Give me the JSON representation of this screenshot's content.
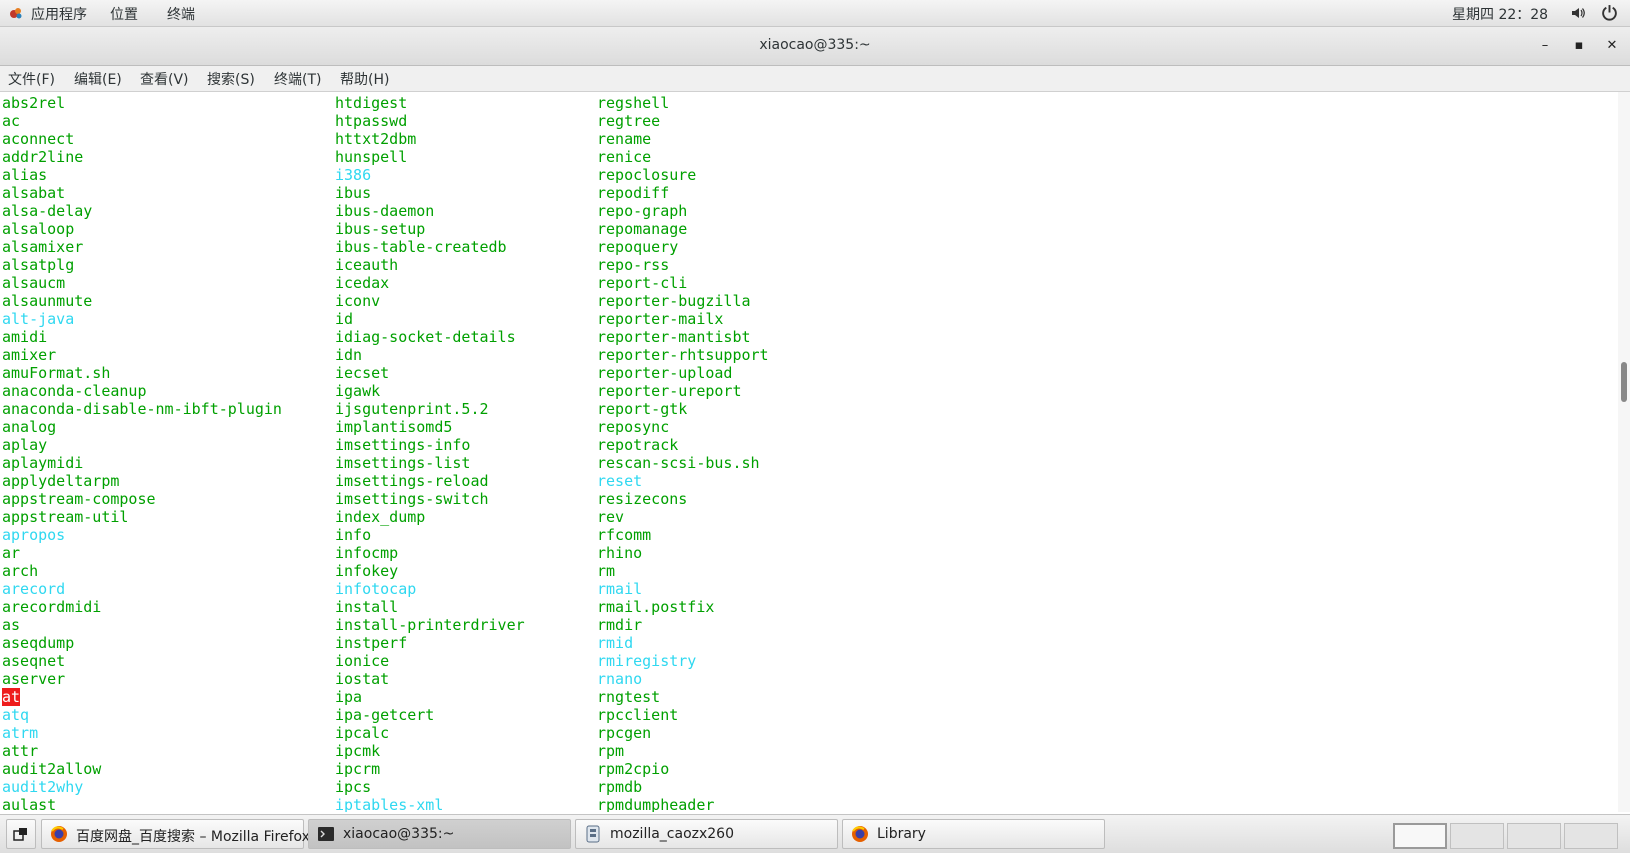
{
  "topbar": {
    "applications_label": "应用程序",
    "places_label": "位置",
    "terminal_app_label": "终端",
    "clock": "星期四 22：28"
  },
  "window": {
    "title": "xiaocao@335:~",
    "minimize_glyph": "–",
    "maximize_glyph": "▪",
    "close_glyph": "✕"
  },
  "menu": {
    "file": "文件(F)",
    "edit": "编辑(E)",
    "view": "查看(V)",
    "search": "搜索(S)",
    "terminal": "终端(T)",
    "help": "帮助(H)"
  },
  "terminal": {
    "colors": {
      "executable": "#00a000",
      "symlink": "#2fd8f0",
      "highlight_bg": "#ee1c1c"
    },
    "columns": [
      [
        {
          "t": "abs2rel",
          "k": "x"
        },
        {
          "t": "ac",
          "k": "x"
        },
        {
          "t": "aconnect",
          "k": "x"
        },
        {
          "t": "addr2line",
          "k": "x"
        },
        {
          "t": "alias",
          "k": "x"
        },
        {
          "t": "alsabat",
          "k": "x"
        },
        {
          "t": "alsa-delay",
          "k": "x"
        },
        {
          "t": "alsaloop",
          "k": "x"
        },
        {
          "t": "alsamixer",
          "k": "x"
        },
        {
          "t": "alsatplg",
          "k": "x"
        },
        {
          "t": "alsaucm",
          "k": "x"
        },
        {
          "t": "alsaunmute",
          "k": "x"
        },
        {
          "t": "alt-java",
          "k": "l"
        },
        {
          "t": "amidi",
          "k": "x"
        },
        {
          "t": "amixer",
          "k": "x"
        },
        {
          "t": "amuFormat.sh",
          "k": "x"
        },
        {
          "t": "anaconda-cleanup",
          "k": "x"
        },
        {
          "t": "anaconda-disable-nm-ibft-plugin",
          "k": "x"
        },
        {
          "t": "analog",
          "k": "x"
        },
        {
          "t": "aplay",
          "k": "x"
        },
        {
          "t": "aplaymidi",
          "k": "x"
        },
        {
          "t": "applydeltarpm",
          "k": "x"
        },
        {
          "t": "appstream-compose",
          "k": "x"
        },
        {
          "t": "appstream-util",
          "k": "x"
        },
        {
          "t": "apropos",
          "k": "l"
        },
        {
          "t": "ar",
          "k": "x"
        },
        {
          "t": "arch",
          "k": "x"
        },
        {
          "t": "arecord",
          "k": "l"
        },
        {
          "t": "arecordmidi",
          "k": "x"
        },
        {
          "t": "as",
          "k": "x"
        },
        {
          "t": "aseqdump",
          "k": "x"
        },
        {
          "t": "aseqnet",
          "k": "x"
        },
        {
          "t": "aserver",
          "k": "x"
        },
        {
          "t": "at",
          "k": "h"
        },
        {
          "t": "atq",
          "k": "l"
        },
        {
          "t": "atrm",
          "k": "l"
        },
        {
          "t": "attr",
          "k": "x"
        },
        {
          "t": "audit2allow",
          "k": "x"
        },
        {
          "t": "audit2why",
          "k": "l"
        },
        {
          "t": "aulast",
          "k": "x"
        }
      ],
      [
        {
          "t": "htdigest",
          "k": "x"
        },
        {
          "t": "htpasswd",
          "k": "x"
        },
        {
          "t": "httxt2dbm",
          "k": "x"
        },
        {
          "t": "hunspell",
          "k": "x"
        },
        {
          "t": "i386",
          "k": "l"
        },
        {
          "t": "ibus",
          "k": "x"
        },
        {
          "t": "ibus-daemon",
          "k": "x"
        },
        {
          "t": "ibus-setup",
          "k": "x"
        },
        {
          "t": "ibus-table-createdb",
          "k": "x"
        },
        {
          "t": "iceauth",
          "k": "x"
        },
        {
          "t": "icedax",
          "k": "x"
        },
        {
          "t": "iconv",
          "k": "x"
        },
        {
          "t": "id",
          "k": "x"
        },
        {
          "t": "idiag-socket-details",
          "k": "x"
        },
        {
          "t": "idn",
          "k": "x"
        },
        {
          "t": "iecset",
          "k": "x"
        },
        {
          "t": "igawk",
          "k": "x"
        },
        {
          "t": "ijsgutenprint.5.2",
          "k": "x"
        },
        {
          "t": "implantisomd5",
          "k": "x"
        },
        {
          "t": "imsettings-info",
          "k": "x"
        },
        {
          "t": "imsettings-list",
          "k": "x"
        },
        {
          "t": "imsettings-reload",
          "k": "x"
        },
        {
          "t": "imsettings-switch",
          "k": "x"
        },
        {
          "t": "index_dump",
          "k": "x"
        },
        {
          "t": "info",
          "k": "x"
        },
        {
          "t": "infocmp",
          "k": "x"
        },
        {
          "t": "infokey",
          "k": "x"
        },
        {
          "t": "infotocap",
          "k": "l"
        },
        {
          "t": "install",
          "k": "x"
        },
        {
          "t": "install-printerdriver",
          "k": "x"
        },
        {
          "t": "instperf",
          "k": "x"
        },
        {
          "t": "ionice",
          "k": "x"
        },
        {
          "t": "iostat",
          "k": "x"
        },
        {
          "t": "ipa",
          "k": "x"
        },
        {
          "t": "ipa-getcert",
          "k": "x"
        },
        {
          "t": "ipcalc",
          "k": "x"
        },
        {
          "t": "ipcmk",
          "k": "x"
        },
        {
          "t": "ipcrm",
          "k": "x"
        },
        {
          "t": "ipcs",
          "k": "x"
        },
        {
          "t": "iptables-xml",
          "k": "l"
        }
      ],
      [
        {
          "t": "regshell",
          "k": "x"
        },
        {
          "t": "regtree",
          "k": "x"
        },
        {
          "t": "rename",
          "k": "x"
        },
        {
          "t": "renice",
          "k": "x"
        },
        {
          "t": "repoclosure",
          "k": "x"
        },
        {
          "t": "repodiff",
          "k": "x"
        },
        {
          "t": "repo-graph",
          "k": "x"
        },
        {
          "t": "repomanage",
          "k": "x"
        },
        {
          "t": "repoquery",
          "k": "x"
        },
        {
          "t": "repo-rss",
          "k": "x"
        },
        {
          "t": "report-cli",
          "k": "x"
        },
        {
          "t": "reporter-bugzilla",
          "k": "x"
        },
        {
          "t": "reporter-mailx",
          "k": "x"
        },
        {
          "t": "reporter-mantisbt",
          "k": "x"
        },
        {
          "t": "reporter-rhtsupport",
          "k": "x"
        },
        {
          "t": "reporter-upload",
          "k": "x"
        },
        {
          "t": "reporter-ureport",
          "k": "x"
        },
        {
          "t": "report-gtk",
          "k": "x"
        },
        {
          "t": "reposync",
          "k": "x"
        },
        {
          "t": "repotrack",
          "k": "x"
        },
        {
          "t": "rescan-scsi-bus.sh",
          "k": "x"
        },
        {
          "t": "reset",
          "k": "l"
        },
        {
          "t": "resizecons",
          "k": "x"
        },
        {
          "t": "rev",
          "k": "x"
        },
        {
          "t": "rfcomm",
          "k": "x"
        },
        {
          "t": "rhino",
          "k": "x"
        },
        {
          "t": "rm",
          "k": "x"
        },
        {
          "t": "rmail",
          "k": "l"
        },
        {
          "t": "rmail.postfix",
          "k": "x"
        },
        {
          "t": "rmdir",
          "k": "x"
        },
        {
          "t": "rmid",
          "k": "l"
        },
        {
          "t": "rmiregistry",
          "k": "l"
        },
        {
          "t": "rnano",
          "k": "l"
        },
        {
          "t": "rngtest",
          "k": "x"
        },
        {
          "t": "rpcclient",
          "k": "x"
        },
        {
          "t": "rpcgen",
          "k": "x"
        },
        {
          "t": "rpm",
          "k": "x"
        },
        {
          "t": "rpm2cpio",
          "k": "x"
        },
        {
          "t": "rpmdb",
          "k": "x"
        },
        {
          "t": "rpmdumpheader",
          "k": "x"
        }
      ]
    ]
  },
  "taskbar": {
    "show_desktop_icon": "show-desktop-icon",
    "tasks": [
      {
        "label": "百度网盘_百度搜索 – Mozilla Firefox",
        "icon": "firefox-icon"
      },
      {
        "label": "xiaocao@335:~",
        "icon": "terminal-icon"
      },
      {
        "label": "mozilla_caozx260",
        "icon": "file-manager-icon"
      },
      {
        "label": "Library",
        "icon": "firefox-icon"
      }
    ]
  }
}
